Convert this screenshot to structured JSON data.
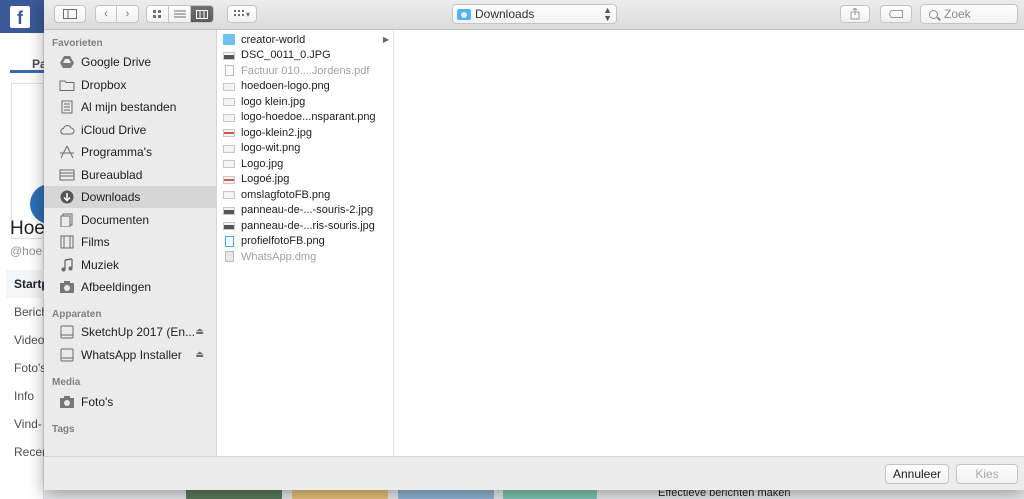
{
  "background": {
    "profile_name": "Hoe",
    "profile_handle": "@hoe",
    "tab_label": "Pa",
    "menu": [
      "Startp",
      "Berich",
      "Video",
      "Foto's",
      "Info",
      "Vind-",
      "Recen"
    ],
    "promo_text": "Effectieve berichten maken"
  },
  "toolbar": {
    "location": "Downloads",
    "search_placeholder": "Zoek"
  },
  "sidebar": {
    "favorites_header": "Favorieten",
    "favorites": [
      {
        "label": "Google Drive",
        "icon": "google-drive-icon"
      },
      {
        "label": "Dropbox",
        "icon": "folder-icon"
      },
      {
        "label": "Al mijn bestanden",
        "icon": "all-files-icon"
      },
      {
        "label": "iCloud Drive",
        "icon": "cloud-icon"
      },
      {
        "label": "Programma's",
        "icon": "applications-icon"
      },
      {
        "label": "Bureaublad",
        "icon": "desktop-icon"
      },
      {
        "label": "Downloads",
        "icon": "downloads-icon"
      },
      {
        "label": "Documenten",
        "icon": "documents-icon"
      },
      {
        "label": "Films",
        "icon": "film-icon"
      },
      {
        "label": "Muziek",
        "icon": "music-icon"
      },
      {
        "label": "Afbeeldingen",
        "icon": "camera-icon"
      }
    ],
    "devices_header": "Apparaten",
    "devices": [
      {
        "label": "SketchUp 2017 (En...",
        "icon": "disk-icon"
      },
      {
        "label": "WhatsApp Installer",
        "icon": "disk-icon"
      }
    ],
    "media_header": "Media",
    "media": [
      {
        "label": "Foto's",
        "icon": "camera-icon"
      }
    ],
    "tags_header": "Tags"
  },
  "files": [
    {
      "name": "creator-world",
      "type": "folder"
    },
    {
      "name": "DSC_0011_0.JPG",
      "type": "img-dark"
    },
    {
      "name": "Factuur 010....Jordens.pdf",
      "type": "doc",
      "dim": true
    },
    {
      "name": "hoedoen-logo.png",
      "type": "img"
    },
    {
      "name": "logo klein.jpg",
      "type": "img"
    },
    {
      "name": "logo-hoedoe...nsparant.png",
      "type": "img"
    },
    {
      "name": "logo-klein2.jpg",
      "type": "img-red"
    },
    {
      "name": "logo-wit.png",
      "type": "img"
    },
    {
      "name": "Logo.jpg",
      "type": "img"
    },
    {
      "name": "Logoé.jpg",
      "type": "img-red"
    },
    {
      "name": "omslagfotoFB.png",
      "type": "img"
    },
    {
      "name": "panneau-de-...-souris-2.jpg",
      "type": "img-dark"
    },
    {
      "name": "panneau-de-...ris-souris.jpg",
      "type": "img-dark"
    },
    {
      "name": "profielfotoFB.png",
      "type": "ptxt"
    },
    {
      "name": "WhatsApp.dmg",
      "type": "dmg",
      "dim": true
    }
  ],
  "footer": {
    "cancel_label": "Annuleer",
    "open_label": "Kies"
  }
}
